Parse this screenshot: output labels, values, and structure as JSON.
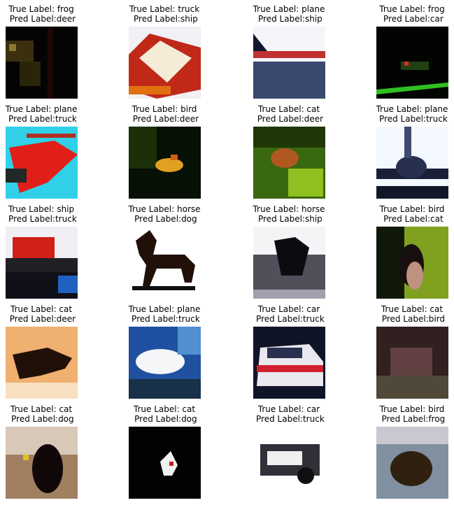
{
  "figure": {
    "rows": 5,
    "cols": 4,
    "true_prefix": "True Label: ",
    "pred_prefix": "Pred Label:"
  },
  "samples": [
    {
      "true_label": "frog",
      "pred_label": "deer",
      "scene": "dark-foliage"
    },
    {
      "true_label": "truck",
      "pred_label": "ship",
      "scene": "red-truck-closeup"
    },
    {
      "true_label": "plane",
      "pred_label": "ship",
      "scene": "plane-on-runway"
    },
    {
      "true_label": "frog",
      "pred_label": "car",
      "scene": "dark-with-green-stripe"
    },
    {
      "true_label": "plane",
      "pred_label": "truck",
      "scene": "red-plane-cyan-sky"
    },
    {
      "true_label": "bird",
      "pred_label": "deer",
      "scene": "yellow-bird-dark-foliage"
    },
    {
      "true_label": "cat",
      "pred_label": "deer",
      "scene": "cat-in-grass"
    },
    {
      "true_label": "plane",
      "pred_label": "truck",
      "scene": "jet-front-view"
    },
    {
      "true_label": "ship",
      "pred_label": "truck",
      "scene": "red-ship-dock"
    },
    {
      "true_label": "horse",
      "pred_label": "dog",
      "scene": "rocking-horse"
    },
    {
      "true_label": "horse",
      "pred_label": "ship",
      "scene": "dark-horse-motion"
    },
    {
      "true_label": "bird",
      "pred_label": "cat",
      "scene": "penguin-green"
    },
    {
      "true_label": "cat",
      "pred_label": "deer",
      "scene": "dark-cat-peach"
    },
    {
      "true_label": "plane",
      "pred_label": "truck",
      "scene": "white-plane-blue-sky"
    },
    {
      "true_label": "car",
      "pred_label": "truck",
      "scene": "white-red-car"
    },
    {
      "true_label": "cat",
      "pred_label": "bird",
      "scene": "dark-speckled"
    },
    {
      "true_label": "cat",
      "pred_label": "dog",
      "scene": "black-cat-beige"
    },
    {
      "true_label": "cat",
      "pred_label": "dog",
      "scene": "white-cat-black"
    },
    {
      "true_label": "car",
      "pred_label": "truck",
      "scene": "bw-car"
    },
    {
      "true_label": "bird",
      "pred_label": "frog",
      "scene": "speckled-animal"
    }
  ]
}
